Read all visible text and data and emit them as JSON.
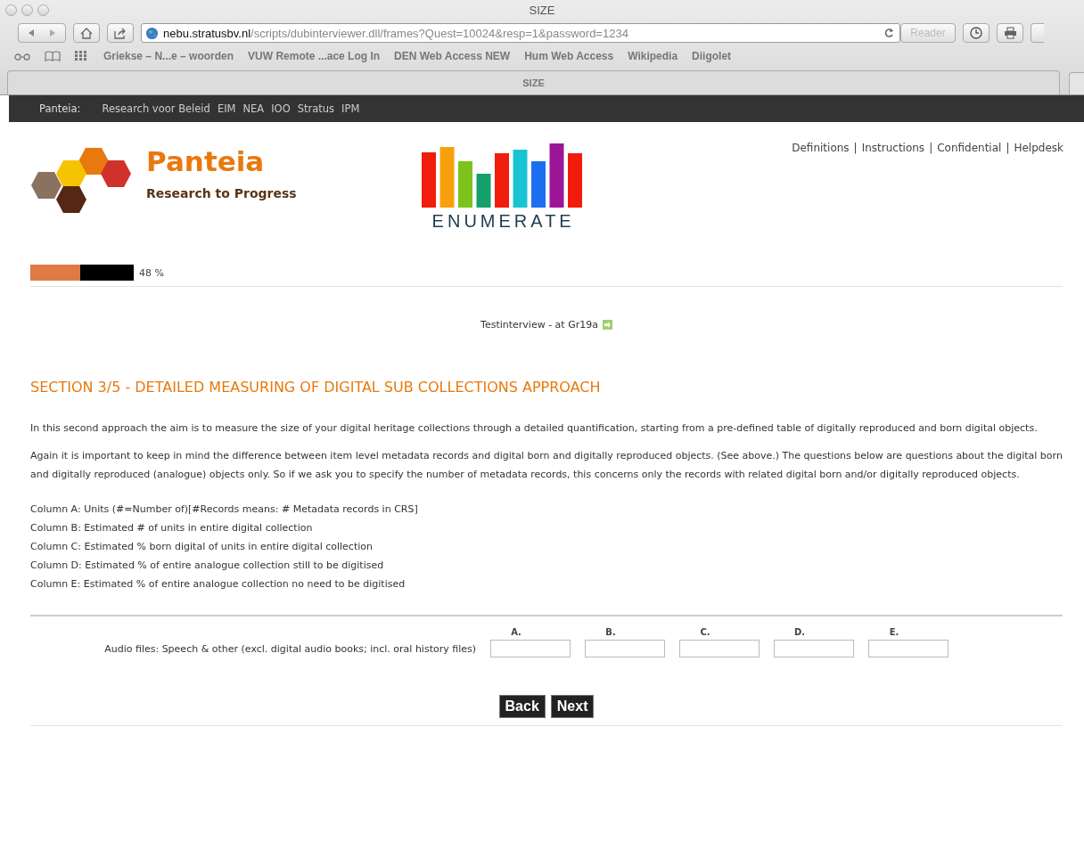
{
  "browser": {
    "title": "SIZE",
    "url_host": "nebu.stratusbv.nl",
    "url_path": "/scripts/dubinterviewer.dll/frames?Quest=10024&resp=1&password=1234",
    "reader": "Reader",
    "bookmarks": [
      "Griekse – N...e – woorden",
      "VUW Remote ...ace Log In",
      "DEN Web Access NEW",
      "Hum Web Access",
      "Wikipedia",
      "Diigolet"
    ],
    "tab": "SIZE"
  },
  "nav": {
    "label": "Panteia:",
    "links": [
      "Research voor Beleid",
      "EIM",
      "NEA",
      "IOO",
      "Stratus",
      "IPM"
    ]
  },
  "header": {
    "brand": "Panteia",
    "tagline": "Research to Progress",
    "partner": "ENUMERATE",
    "links": [
      "Definitions",
      "Instructions",
      "Confidential",
      "Helpdesk"
    ],
    "separator": "|"
  },
  "progress": {
    "level": 0.48,
    "reading": "48 %"
  },
  "interview": "Testinterview - at Gr19a",
  "section_title": "SECTION 3/5 - DETAILED MEASURING OF DIGITAL SUB COLLECTIONS APPROACH",
  "paragraphs": [
    "In this second approach the aim is to measure the size of your digital heritage collections through a detailed quantification, starting from a pre-defined table of digitally reproduced and born digital objects.",
    "Again it is important to keep in mind the difference between item level metadata records and digital born and digitally reproduced objects. (See above.) The questions below are questions about the digital born and digitally reproduced (analogue) objects only. So if we ask you to specify the number of metadata records, this concerns only the records with related digital born and/or digitally reproduced objects."
  ],
  "column_notes": [
    "Column A: Units (#=Number of)[#Records means: # Metadata records in CRS]",
    "Column B: Estimated # of units in entire digital collection",
    "Column C: Estimated % born digital of units in entire digital collection",
    "Column D: Estimated % of entire analogue collection still to be digitised",
    "Column E: Estimated % of entire analogue collection no need to be digitised"
  ],
  "table": {
    "columns": [
      "A.",
      "B.",
      "C.",
      "D.",
      "E."
    ],
    "rows": [
      {
        "label": "Audio files: Speech & other (excl. digital audio books; incl. oral history files)"
      }
    ]
  },
  "buttons": [
    "Back",
    "Next"
  ]
}
